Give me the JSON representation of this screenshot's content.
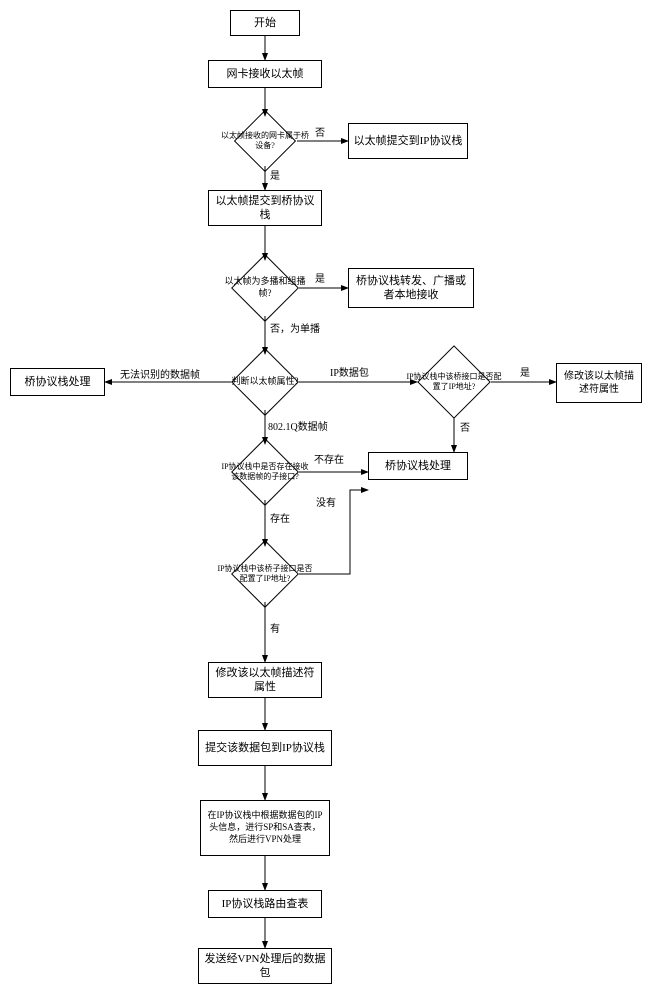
{
  "chart_data": {
    "type": "flowchart",
    "title": "",
    "nodes": [
      {
        "id": "start",
        "label": "开始",
        "shape": "rect"
      },
      {
        "id": "recv",
        "label": "网卡接收以太帧",
        "shape": "rect"
      },
      {
        "id": "d1",
        "label": "以太帧接收的网卡属于桥设备?",
        "shape": "diamond"
      },
      {
        "id": "toip",
        "label": "以太帧提交到IP协议栈",
        "shape": "rect"
      },
      {
        "id": "tobridge",
        "label": "以太帧提交到桥协议栈",
        "shape": "rect"
      },
      {
        "id": "d2",
        "label": "以太帧为多播和组播帧?",
        "shape": "diamond"
      },
      {
        "id": "bcast",
        "label": "桥协议栈转发、广播或者本地接收",
        "shape": "rect"
      },
      {
        "id": "d3",
        "label": "判断以太帧属性?",
        "shape": "diamond"
      },
      {
        "id": "bproc_left",
        "label": "桥协议栈处理",
        "shape": "rect"
      },
      {
        "id": "d4",
        "label": "IP协议栈中该桥接口是否配置了IP地址?",
        "shape": "diamond"
      },
      {
        "id": "mod_right",
        "label": "修改该以太帧描述符属性",
        "shape": "rect"
      },
      {
        "id": "d5",
        "label": "IP协议栈中是否存在接收该数据帧的子接口?",
        "shape": "diamond"
      },
      {
        "id": "bproc_mid",
        "label": "桥协议栈处理",
        "shape": "rect"
      },
      {
        "id": "d6",
        "label": "IP协议栈中该桥子接口是否配置了IP地址?",
        "shape": "diamond"
      },
      {
        "id": "mod_left",
        "label": "修改该以太帧描述符属性",
        "shape": "rect"
      },
      {
        "id": "submitip",
        "label": "提交该数据包到IP协议栈",
        "shape": "rect"
      },
      {
        "id": "vpn",
        "label": "在IP协议栈中根据数据包的IP头信息，进行SP和SA查表，然后进行VPN处理",
        "shape": "rect"
      },
      {
        "id": "route",
        "label": "IP协议栈路由查表",
        "shape": "rect"
      },
      {
        "id": "send",
        "label": "发送经VPN处理后的数据包",
        "shape": "rect"
      }
    ],
    "edges": [
      {
        "from": "start",
        "to": "recv"
      },
      {
        "from": "recv",
        "to": "d1"
      },
      {
        "from": "d1",
        "to": "toip",
        "label": "否"
      },
      {
        "from": "d1",
        "to": "tobridge",
        "label": "是"
      },
      {
        "from": "tobridge",
        "to": "d2"
      },
      {
        "from": "d2",
        "to": "bcast",
        "label": "是"
      },
      {
        "from": "d2",
        "to": "d3",
        "label": "否，为单播"
      },
      {
        "from": "d3",
        "to": "bproc_left",
        "label": "无法识别的数据帧"
      },
      {
        "from": "d3",
        "to": "d4",
        "label": "IP数据包"
      },
      {
        "from": "d3",
        "to": "d5",
        "label": "802.1Q数据帧"
      },
      {
        "from": "d4",
        "to": "mod_right",
        "label": "是"
      },
      {
        "from": "d4",
        "to": "bproc_mid",
        "label": "否"
      },
      {
        "from": "d5",
        "to": "bproc_mid",
        "label": "不存在"
      },
      {
        "from": "d5",
        "to": "d6",
        "label": "存在"
      },
      {
        "from": "d6",
        "to": "bproc_mid",
        "label": "没有"
      },
      {
        "from": "d6",
        "to": "mod_left",
        "label": "有"
      },
      {
        "from": "mod_left",
        "to": "submitip"
      },
      {
        "from": "submitip",
        "to": "vpn"
      },
      {
        "from": "vpn",
        "to": "route"
      },
      {
        "from": "route",
        "to": "send"
      }
    ]
  },
  "labels": {
    "start": "开始",
    "recv": "网卡接收以太帧",
    "d1": "以太帧接收的网卡属于桥设备?",
    "toip": "以太帧提交到IP协议栈",
    "tobridge": "以太帧提交到桥协议栈",
    "d2": "以太帧为多播和组播帧?",
    "bcast": "桥协议栈转发、广播或者本地接收",
    "d3": "判断以太帧属性?",
    "bproc_left": "桥协议栈处理",
    "d4": "IP协议栈中该桥接口是否配置了IP地址?",
    "mod_right": "修改该以太帧描述符属性",
    "d5": "IP协议栈中是否存在接收该数据帧的子接口?",
    "bproc_mid": "桥协议栈处理",
    "d6": "IP协议栈中该桥子接口是否配置了IP地址?",
    "mod_left": "修改该以太帧描述符属性",
    "submitip": "提交该数据包到IP协议栈",
    "vpn": "在IP协议栈中根据数据包的IP头信息，进行SP和SA查表，然后进行VPN处理",
    "route": "IP协议栈路由查表",
    "send": "发送经VPN处理后的数据包"
  },
  "edge_labels": {
    "no1": "否",
    "yes1": "是",
    "yes2": "是",
    "no2": "否，为单播",
    "unrec": "无法识别的数据帧",
    "ipd": "IP数据包",
    "q8021": "802.1Q数据帧",
    "yes4": "是",
    "no4": "否",
    "nexist": "不存在",
    "exist": "存在",
    "no6": "没有",
    "yes6": "有"
  }
}
